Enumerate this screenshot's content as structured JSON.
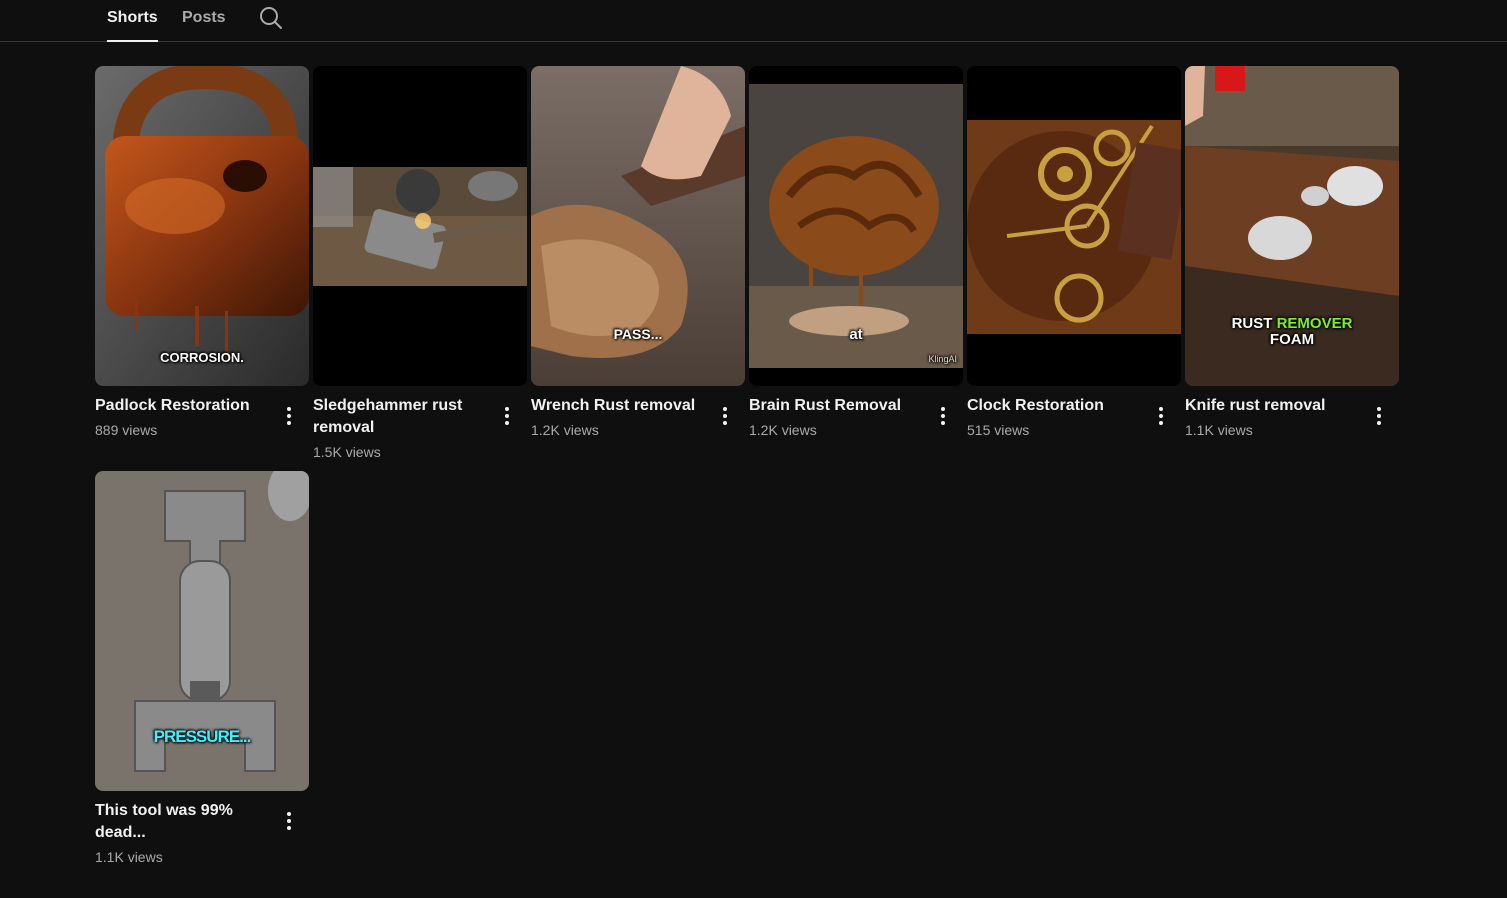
{
  "tabs": [
    {
      "label": "Shorts",
      "active": true
    },
    {
      "label": "Posts",
      "active": false
    }
  ],
  "search": {
    "icon": "search-icon"
  },
  "shorts": [
    {
      "title": "Padlock Restoration",
      "views": "889 views",
      "overlay": "CORROSION."
    },
    {
      "title": "Sledgehammer rust removal",
      "views": "1.5K views",
      "overlay": ""
    },
    {
      "title": "Wrench Rust removal",
      "views": "1.2K views",
      "overlay": "PASS..."
    },
    {
      "title": "Brain Rust Removal",
      "views": "1.2K views",
      "overlay": "at",
      "watermark": "KlingAI"
    },
    {
      "title": "Clock Restoration",
      "views": "515 views",
      "overlay": ""
    },
    {
      "title": "Knife rust removal",
      "views": "1.1K views",
      "overlay_line1_a": "RUST",
      "overlay_line1_b": "REMOVER",
      "overlay_line2": "FOAM"
    },
    {
      "title": "This tool was 99% dead...",
      "views": "1.1K views",
      "overlay": "PRESSURE..."
    }
  ],
  "colors": {
    "background": "#0f0f0f",
    "text_primary": "#f1f1f1",
    "text_secondary": "#aaaaaa",
    "accent_green": "#7cf21a",
    "accent_cyan": "#3df2ff"
  }
}
